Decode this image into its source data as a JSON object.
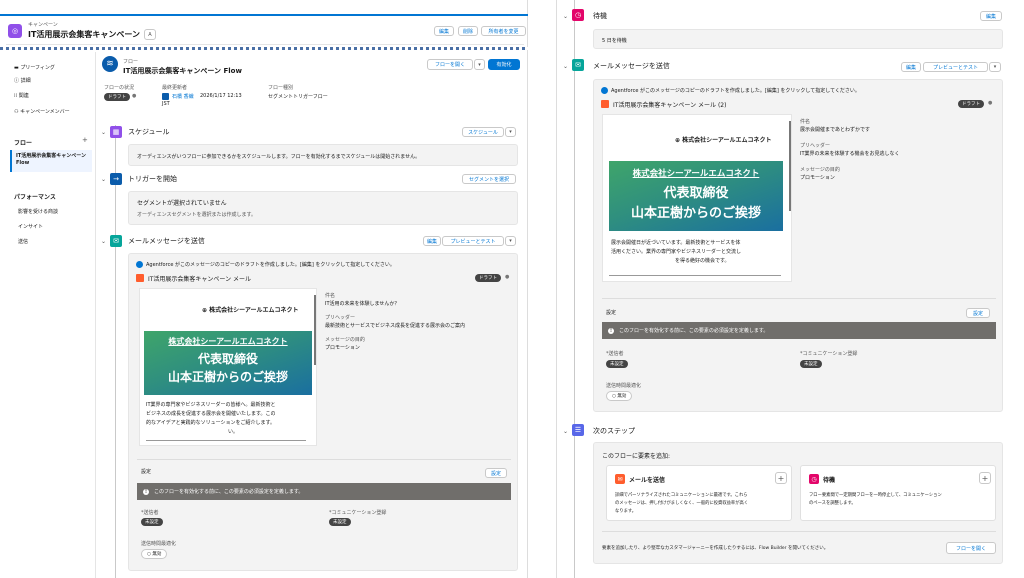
{
  "header": {
    "object_type": "キャンペーン",
    "title": "IT活用展示会集客キャンペーン",
    "buttons": [
      "編集",
      "削除",
      "所有者を変更"
    ]
  },
  "sidebar": {
    "items": [
      "プリーフィング",
      "詳細",
      "関連",
      "キャンペーンメンバー"
    ],
    "flow_title": "フロー",
    "flow_item": "IT活用展示会集客キャンペーン Flow",
    "perf_title": "パフォーマンス",
    "perf_items": [
      "影響を受ける商談",
      "インサイト",
      "送信"
    ]
  },
  "flow": {
    "type_label": "フロー",
    "name": "IT活用展示会集客キャンペーン Flow",
    "open_btn": "フローを開く",
    "activate_btn": "有効化",
    "status_label": "フローの状況",
    "status": "ドラフト",
    "modified_label": "最終更新者",
    "modified_by": "石橋 香織",
    "modified_at": "2026/1/17 12:13",
    "modified_tz": "JST",
    "flow_type_label": "フロー種別",
    "flow_type": "セグメントトリガーフロー"
  },
  "schedule": {
    "title": "スケジュール",
    "btn": "スケジュール",
    "desc": "オーディエンスがいつフローに参加できるかをスケジュールします。フローを有効化するまでスケジュールは開始されません。"
  },
  "trigger": {
    "title": "トリガーを開始",
    "btn": "セグメントを選択",
    "line1": "セグメントが選択されていません",
    "line2": "オーディエンスセグメントを選択または作成します。"
  },
  "email1": {
    "title": "メールメッセージを送信",
    "edit": "編集",
    "preview": "プレビューとテスト",
    "agent_note": "Agentforce がこのメッセージのコピーのドラフトを作成しました。[編集] をクリックして指定してください。",
    "mail_name": "IT活用展示会集客キャンペーン メール",
    "draft": "ドラフト",
    "company": "株式会社シーアールエムコネクト",
    "hero_title": "株式会社シーアールエムコネクト",
    "hero_line1": "代表取締役",
    "hero_line2": "山本正樹からのご挨拶",
    "body": [
      "IT業界の専門家やビジネスリーダーの皆様へ。最新技術と",
      "ビジネスの成長を促進する展示会を開催いたします。この",
      "的なアイデアと実践的なソリューションをご紹介します。",
      "い。"
    ],
    "subject_label": "件名",
    "subject": "IT活用の未来を体験しませんか？",
    "preheader_label": "プリヘッダー",
    "preheader": "最新技術とサービスでビジネス成長を促進する展示会のご案内",
    "purpose_label": "メッセージの目的",
    "purpose": "プロモーション",
    "settings": "設定",
    "settings_btn": "設定",
    "warning": "このフローを有効化する前に、この要素の必須設定を定義します。",
    "sender_label": "*送信者",
    "sender": "未設定",
    "commsub_label": "*コミュニケーション登録",
    "commsub": "未設定",
    "opt_label": "送信時間最適化",
    "opt": "無効"
  },
  "wait": {
    "title": "待機",
    "edit": "編集",
    "desc": "5 日を待機"
  },
  "email2": {
    "title": "メールメッセージを送信",
    "edit": "編集",
    "preview": "プレビューとテスト",
    "agent_note": "Agentforce がこのメッセージのコピーのドラフトを作成しました。[編集] をクリックして指定してください。",
    "mail_name": "IT活用展示会集客キャンペーン メール (2)",
    "draft": "ドラフト",
    "company": "株式会社シーアールエムコネクト",
    "hero_title": "株式会社シーアールエムコネクト",
    "hero_line1": "代表取締役",
    "hero_line2": "山本正樹からのご挨拶",
    "body": [
      "展示会開催日が近づいています。最新技術とサービスを体",
      "活用ください。業界の専門家やビジネスリーダーと交流し",
      "を得る絶好の機会です。"
    ],
    "subject_label": "件名",
    "subject": "展示会開催まであとわずかです",
    "preheader_label": "プリヘッダー",
    "preheader": "IT業界の未来を体験する機会をお見逃しなく",
    "purpose_label": "メッセージの目的",
    "purpose": "プロモーション",
    "settings": "設定",
    "settings_btn": "設定",
    "warning": "このフローを有効化する前に、この要素の必須設定を定義します。",
    "sender_label": "*送信者",
    "sender": "未設定",
    "commsub_label": "*コミュニケーション登録",
    "commsub": "未設定",
    "opt_label": "送信時間最適化",
    "opt": "無効"
  },
  "next": {
    "title": "次のステップ",
    "add_label": "このフローに要素を追加:",
    "card1_title": "メールを送信",
    "card1_desc": [
      "詳細でパーソナライズされたコミュニケーションに最適です。これら",
      "のメッセージは、押し付けがましくなく、一般的に投資収益率が高く",
      "なります。"
    ],
    "card2_title": "待機",
    "card2_desc": [
      "フロー要素間で一定期間フローを一時停止して、コミュニケーション",
      "のペースを調整します。"
    ],
    "footer": "要素を追加したり、より堅牢なカスタマージャーニーを作成したりするには、Flow Builder を開いてください。",
    "open_btn": "フローを開く"
  },
  "colors": {
    "blue": "#0176d3",
    "purple": "#9050e9",
    "orange": "#ff5d2d",
    "teal": "#06a59a",
    "pink": "#e3066a",
    "navy": "#0b5cab",
    "indigo": "#5867e8"
  }
}
